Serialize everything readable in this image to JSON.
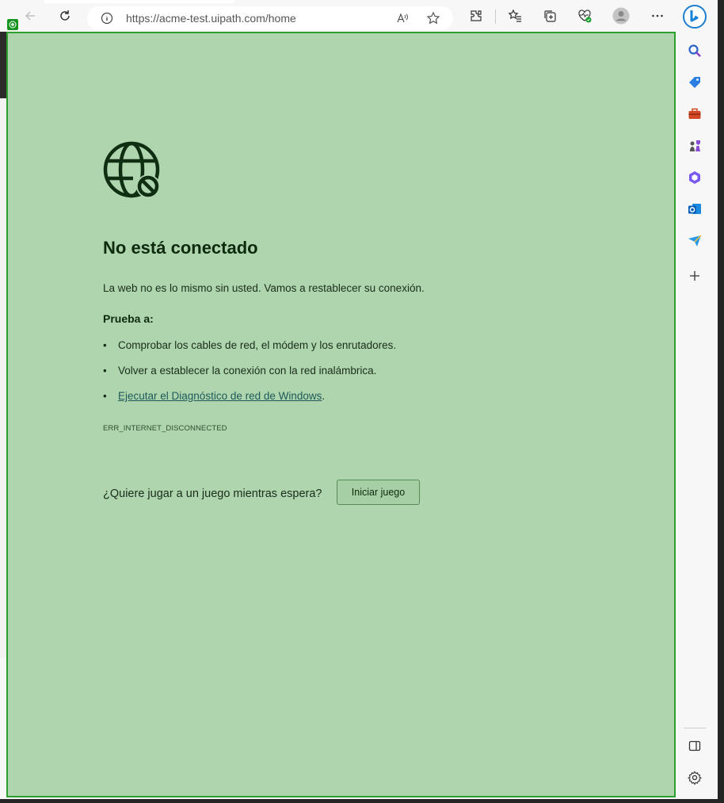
{
  "browser": {
    "url": "https://acme-test.uipath.com/home",
    "icons": [
      "back-icon",
      "refresh-icon",
      "info-icon",
      "read-aloud-icon",
      "favorite-star-icon",
      "extensions-icon",
      "favorites-icon",
      "collections-icon",
      "health-icon",
      "profile-icon",
      "more-icon",
      "bing-icon"
    ]
  },
  "error_page": {
    "title": "No está conectado",
    "description": "La web no es lo mismo sin usted. Vamos a restablecer su conexión.",
    "try_heading": "Prueba a:",
    "bullet": "•",
    "suggestions": [
      "Comprobar los cables de red, el módem y los enrutadores.",
      "Volver a establecer la conexión con la red inalámbrica."
    ],
    "diagnostic_link": "Ejecutar el Diagnóstico de red de Windows",
    "diagnostic_suffix": ".",
    "error_code": "ERR_INTERNET_DISCONNECTED",
    "game_question": "¿Quiere jugar a un juego mientras espera?",
    "game_button": "Iniciar juego"
  },
  "sidebar": {
    "icons": [
      "search-icon",
      "shopping-tag-icon",
      "tools-icon",
      "games-icon",
      "office-icon",
      "outlook-icon",
      "send-icon",
      "add-icon",
      "split-screen-icon",
      "settings-icon"
    ]
  },
  "colors": {
    "page_background": "#aed5ad",
    "highlight_border": "#2ca02c",
    "heading_text": "#0d2a0d"
  }
}
